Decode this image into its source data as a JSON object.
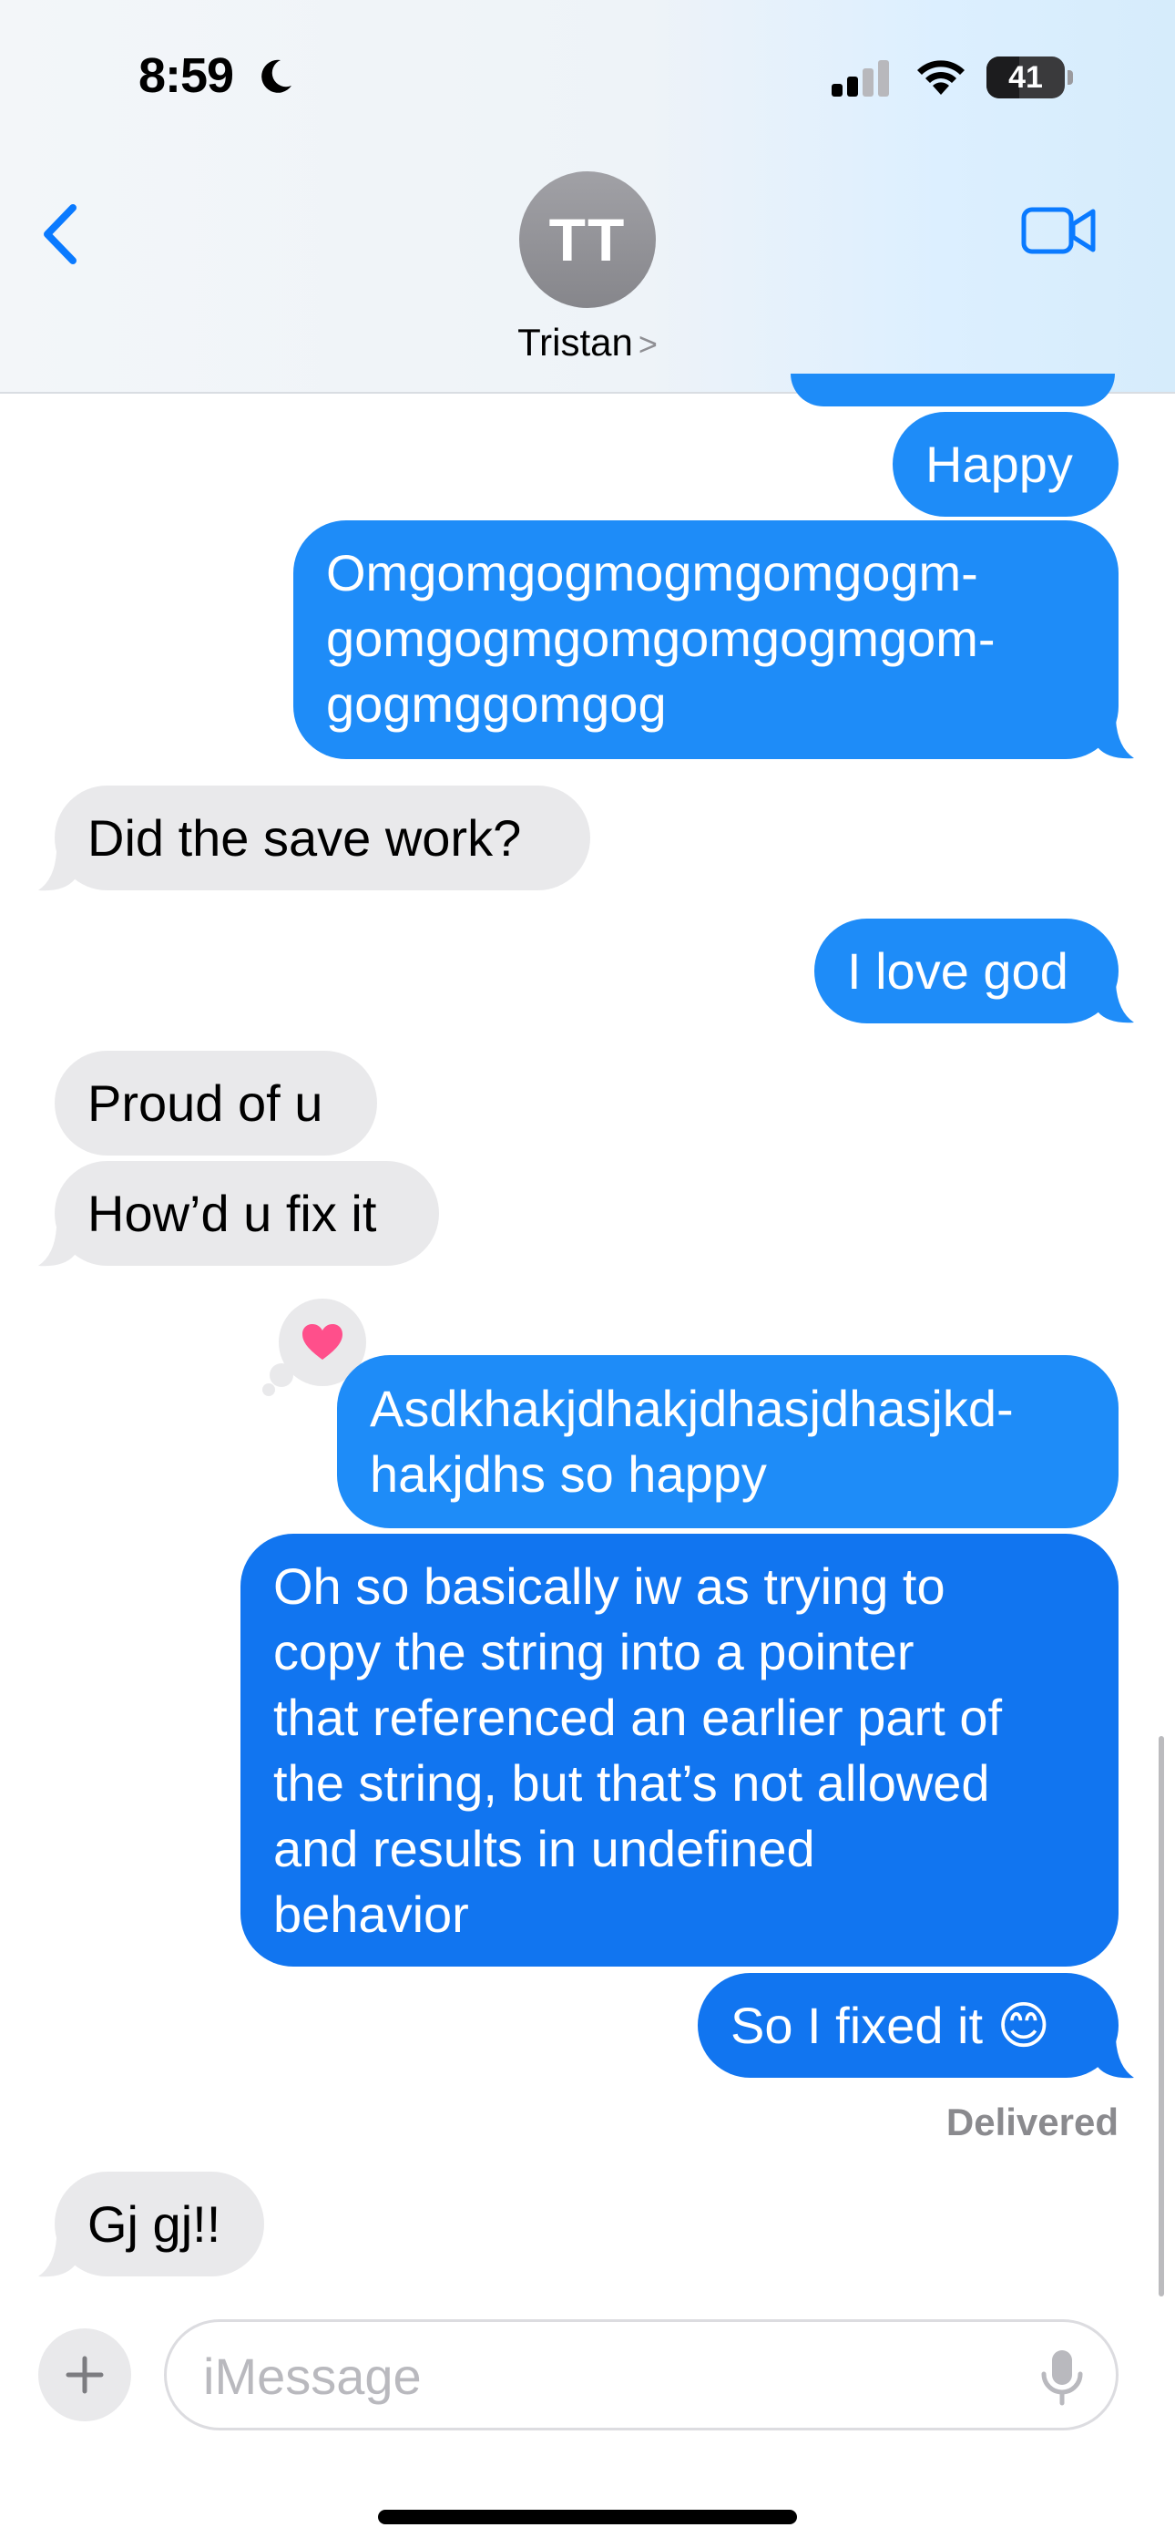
{
  "status_bar": {
    "time": "8:59",
    "battery": "41"
  },
  "header": {
    "avatar_initials": "TT",
    "contact_name": "Tristan",
    "chevron": ">"
  },
  "messages": [
    {
      "side": "out",
      "text": "Happy"
    },
    {
      "side": "out",
      "text": "Omgomgogmogmgomgogm-\ngomgogmgomgomgogmgom-\ngogmggomgog"
    },
    {
      "side": "in",
      "text": "Did the save work?"
    },
    {
      "side": "out",
      "text": "I love god"
    },
    {
      "side": "in",
      "text": "Proud of u"
    },
    {
      "side": "in",
      "text": "How’d u fix it"
    },
    {
      "side": "out",
      "text": "Asdkhakjdhakjdhasjdhasjkd-\nhakjdhs so happy",
      "reaction": "heart"
    },
    {
      "side": "out",
      "text": "Oh so basically iw as trying to\ncopy the string into a pointer\nthat referenced an earlier part of\nthe string, but that’s not allowed\nand results in undefined\nbehavior"
    },
    {
      "side": "out",
      "text": "So I fixed it 😊"
    },
    {
      "side": "in",
      "text": "Gj gj!!"
    }
  ],
  "delivered_label": "Delivered",
  "composer": {
    "placeholder": "iMessage"
  }
}
